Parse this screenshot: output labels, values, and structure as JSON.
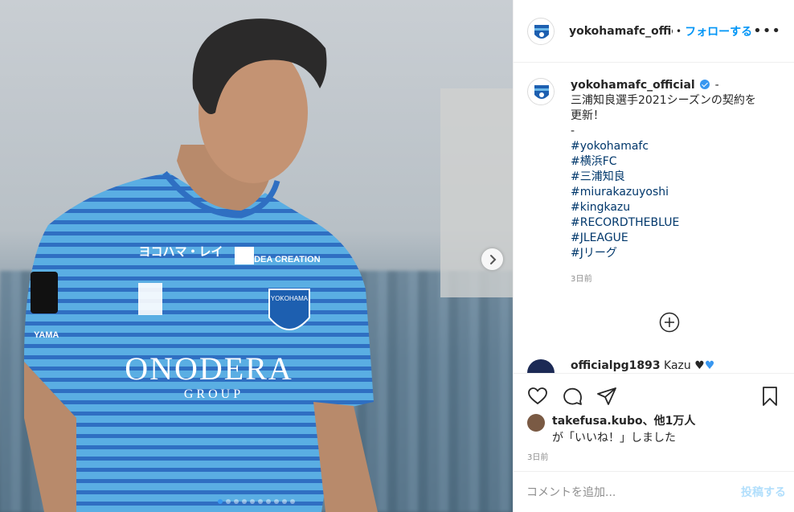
{
  "post": {
    "image_alt": "player photo",
    "jersey_sponsor": "ONODERA",
    "jersey_sponsor_sub": "GROUP",
    "jersey_chest_left": "ヨコハマ・レイ",
    "jersey_chest_right": "FUDEA CREATION",
    "crest_text": "YOKOHAMA",
    "sleeve_text": "YAMA",
    "carousel_dots": 10,
    "carousel_active": 0
  },
  "header": {
    "username": "yokohamafc_official",
    "separator": "•",
    "follow_label": "フォローする",
    "more_label": "•••"
  },
  "caption": {
    "username": "yokohamafc_official",
    "dash": "-",
    "text_line1": "三浦知良選手2021シーズンの契約を",
    "text_line2": "更新！",
    "dash2": "-",
    "hashtags": [
      "#yokohamafc",
      "#横浜FC",
      "#三浦知良",
      "#miurakazuyoshi",
      "#kingkazu",
      "#RECORDTHEBLUE",
      "#JLEAGUE",
      "#Jリーグ"
    ],
    "time": "3日前"
  },
  "peek_comment": {
    "username": "officialpg1893",
    "text": "Kazu"
  },
  "actions": {
    "like": "heart-icon",
    "comment": "comment-icon",
    "share": "share-icon",
    "save": "bookmark-icon"
  },
  "likes": {
    "liker": "takefusa.kubo",
    "others": "、他1万人",
    "suffix": "が「いいね！」しました",
    "time": "3日前"
  },
  "comment_box": {
    "placeholder": "コメントを追加...",
    "post_label": "投稿する"
  },
  "colors": {
    "accent": "#0095f6",
    "link": "#00376b",
    "muted": "#8e8e8e",
    "jersey": "#4a9fd8"
  }
}
